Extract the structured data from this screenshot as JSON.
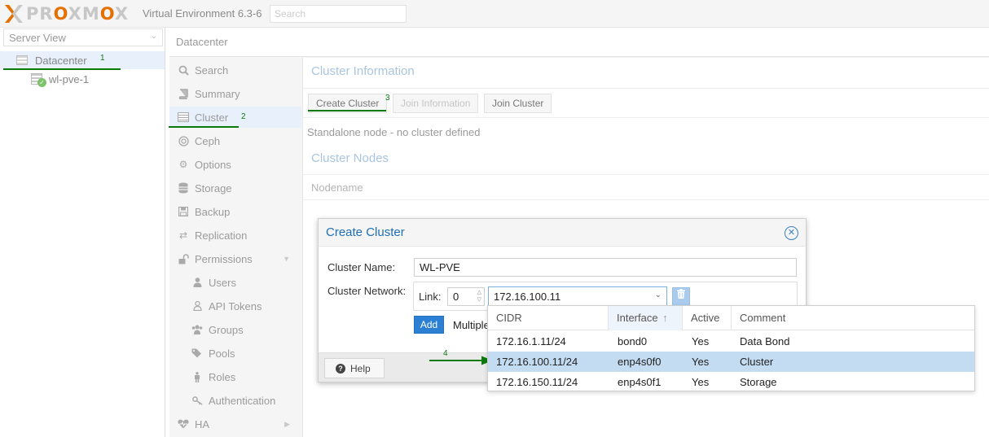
{
  "header": {
    "logo_text": "PROXMOX",
    "version": "Virtual Environment 6.3-6",
    "search_placeholder": "Search"
  },
  "tree": {
    "view": "Server View",
    "datacenter": "Datacenter",
    "node": "wl-pve-1"
  },
  "breadcrumb": "Datacenter",
  "menu": {
    "items": [
      "Search",
      "Summary",
      "Cluster",
      "Ceph",
      "Options",
      "Storage",
      "Backup",
      "Replication",
      "Permissions"
    ],
    "sub_items": [
      "Users",
      "API Tokens",
      "Groups",
      "Pools",
      "Roles",
      "Authentication"
    ],
    "last_item": "HA"
  },
  "panel": {
    "title": "Cluster Information",
    "create_label": "Create Cluster",
    "join_info_label": "Join Information",
    "join_label": "Join Cluster",
    "status": "Standalone node - no cluster defined",
    "nodes_title": "Cluster Nodes",
    "nodes_column": "Nodename"
  },
  "annotations": [
    "1",
    "2",
    "3",
    "4"
  ],
  "modal": {
    "title": "Create Cluster",
    "cluster_name_label": "Cluster Name:",
    "cluster_name_value": "WL-PVE",
    "network_label": "Cluster Network:",
    "link_label": "Link:",
    "link_value": "0",
    "interface_value": "172.16.100.11",
    "add_label": "Add",
    "multiple_text": "Multiple",
    "help_label": "Help"
  },
  "dropdown": {
    "columns": [
      "CIDR",
      "Interface",
      "Active",
      "Comment"
    ],
    "rows": [
      {
        "cidr": "172.16.1.11/24",
        "iface": "bond0",
        "active": "Yes",
        "comment": "Data Bond"
      },
      {
        "cidr": "172.16.100.11/24",
        "iface": "enp4s0f0",
        "active": "Yes",
        "comment": "Cluster"
      },
      {
        "cidr": "172.16.150.11/24",
        "iface": "enp4s0f1",
        "active": "Yes",
        "comment": "Storage"
      }
    ]
  },
  "colors": {
    "accent": "#e57000",
    "title_blue": "#1f6eb5",
    "annotation_green": "#0a7a0a",
    "selection": "#c4dcf2"
  }
}
